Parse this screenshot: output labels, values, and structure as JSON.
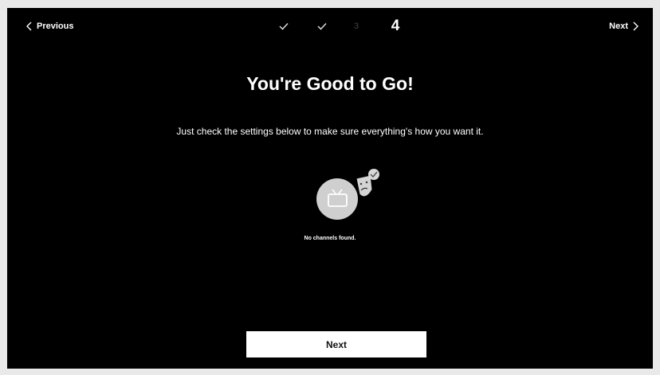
{
  "nav": {
    "previous_label": "Previous",
    "next_label": "Next"
  },
  "stepper": {
    "steps": [
      {
        "state": "done",
        "icon": "checkmark-icon"
      },
      {
        "state": "done",
        "icon": "checkmark-icon"
      },
      {
        "state": "upcoming",
        "label": "3"
      },
      {
        "state": "current",
        "label": "4"
      }
    ]
  },
  "main": {
    "title": "You're Good to Go!",
    "subtitle": "Just check the settings below to make sure everything's how you want it.",
    "status_caption": "No channels found.",
    "next_button_label": "Next"
  },
  "colors": {
    "background": "#000000",
    "text": "#ffffff",
    "button_bg": "#ffffff",
    "button_text": "#111111",
    "icon_circle": "#cfcfcf"
  }
}
